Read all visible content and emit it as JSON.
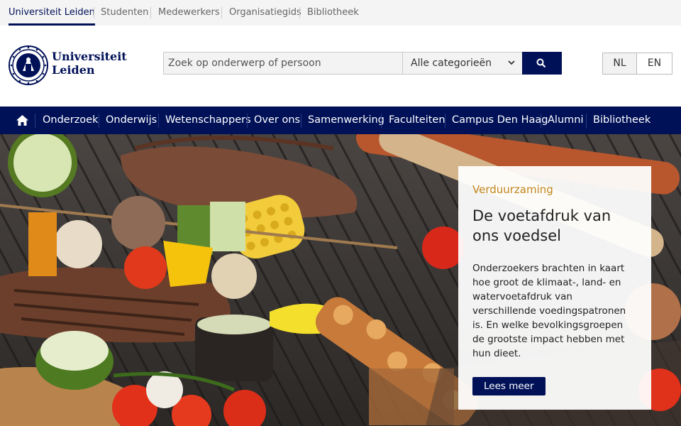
{
  "topbar": {
    "links": [
      "Universiteit Leiden",
      "Studenten",
      "Medewerkers",
      "Organisatiegids",
      "Bibliotheek"
    ]
  },
  "logo": {
    "line1": "Universiteit",
    "line2": "Leiden"
  },
  "search": {
    "placeholder": "Zoek op onderwerp of persoon",
    "category": "Alle categorieën"
  },
  "lang": {
    "nl": "NL",
    "en": "EN"
  },
  "nav": [
    "Onderzoek",
    "Onderwijs",
    "Wetenschappers",
    "Over ons",
    "Samenwerking",
    "Faculteiten",
    "Campus Den Haag",
    "Alumni",
    "Bibliotheek"
  ],
  "hero": {
    "kicker": "Verduurzaming",
    "title": "De voetafdruk van ons voedsel",
    "body": "Onderzoekers brachten in kaart hoe groot de klimaat-, land- en watervoetafdruk van verschillende voedingspatronen is. En welke bevolkingsgroepen de grootste impact hebben met hun dieet.",
    "button": "Lees meer"
  },
  "colors": {
    "brand": "#001158",
    "accent": "#c1861b"
  },
  "icons": {
    "search": "search-icon",
    "home": "home-icon",
    "chevron": "chevron-down-icon"
  }
}
